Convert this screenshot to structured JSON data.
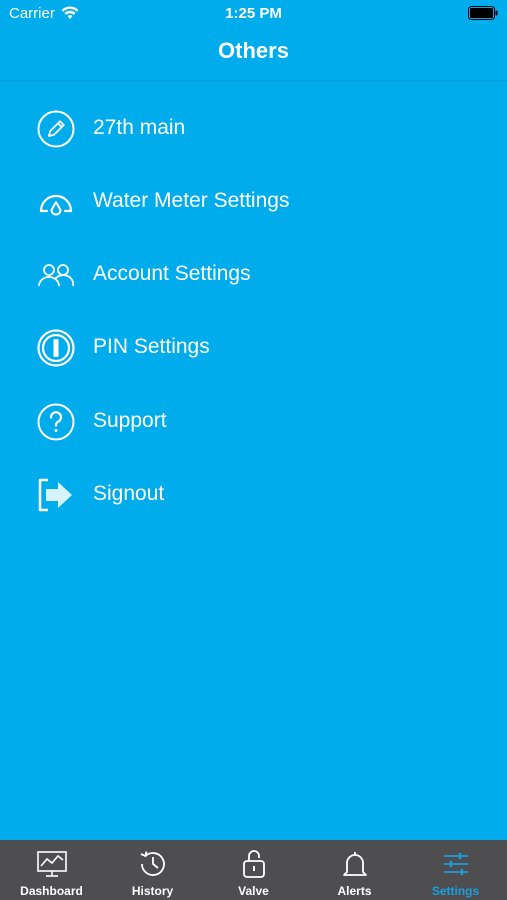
{
  "status_bar": {
    "carrier": "Carrier",
    "time": "1:25 PM"
  },
  "header": {
    "title": "Others"
  },
  "menu": {
    "items": [
      {
        "label": "27th main",
        "icon": "pencil-icon"
      },
      {
        "label": "Water Meter Settings",
        "icon": "gauge-icon"
      },
      {
        "label": "Account Settings",
        "icon": "users-icon"
      },
      {
        "label": "PIN Settings",
        "icon": "pin-icon"
      },
      {
        "label": "Support",
        "icon": "question-icon"
      },
      {
        "label": "Signout",
        "icon": "signout-icon"
      }
    ]
  },
  "tab_bar": {
    "tabs": [
      {
        "label": "Dashboard",
        "icon": "dashboard-icon"
      },
      {
        "label": "History",
        "icon": "history-icon"
      },
      {
        "label": "Valve",
        "icon": "lock-icon"
      },
      {
        "label": "Alerts",
        "icon": "bell-icon"
      },
      {
        "label": "Settings",
        "icon": "sliders-icon",
        "active": true
      }
    ]
  },
  "colors": {
    "background": "#00acec",
    "tab_bar": "#4e4e50",
    "tab_active": "#1a9fe0",
    "text": "#ffffff"
  }
}
